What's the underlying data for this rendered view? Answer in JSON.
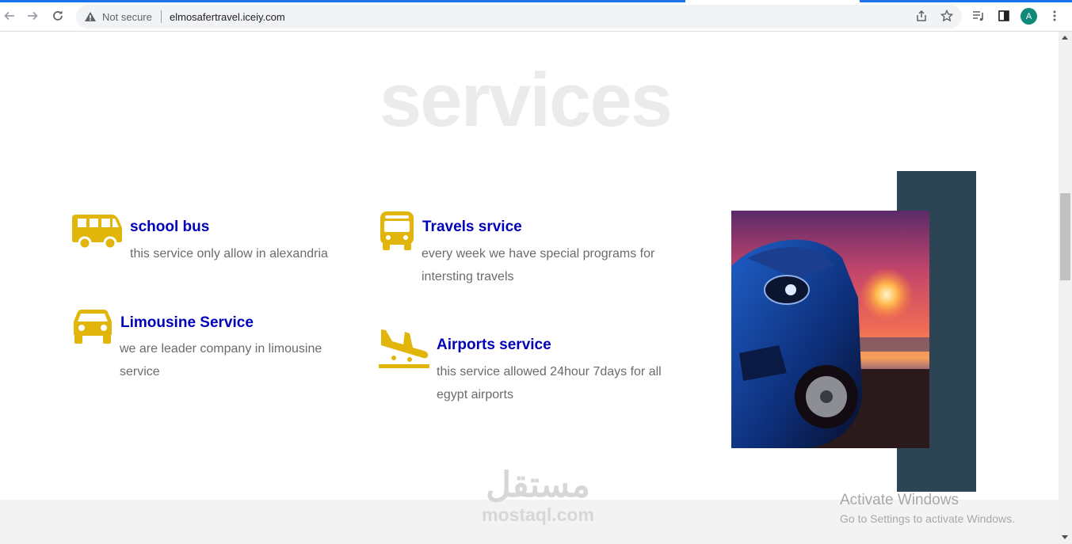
{
  "browser": {
    "security_label": "Not secure",
    "url": "elmosafertravel.iceiy.com",
    "profile_initial": "A"
  },
  "page": {
    "heading": "services",
    "services": [
      {
        "title": "school bus",
        "description": "this service only allow in alexandria",
        "icon": "bus-icon"
      },
      {
        "title": "Travels srvice",
        "description": "every week we have special programs for intersting travels",
        "icon": "coach-bus-icon"
      },
      {
        "title": "Limousine Service",
        "description": "we are leader company in limousine service",
        "icon": "car-icon"
      },
      {
        "title": "Airports service",
        "description": "this service allowed 24hour 7days for all egypt airports",
        "icon": "plane-landing-icon"
      }
    ],
    "colors": {
      "accent_icon": "#e1b50a",
      "title": "#0000b8",
      "text": "#6b6b6b",
      "dark_block": "#2c4454",
      "heading_watermark": "#ebebeb"
    }
  },
  "watermark": {
    "arabic": "مستقل",
    "latin": "mostaql.com"
  },
  "os_overlay": {
    "title": "Activate Windows",
    "subtitle": "Go to Settings to activate Windows."
  }
}
